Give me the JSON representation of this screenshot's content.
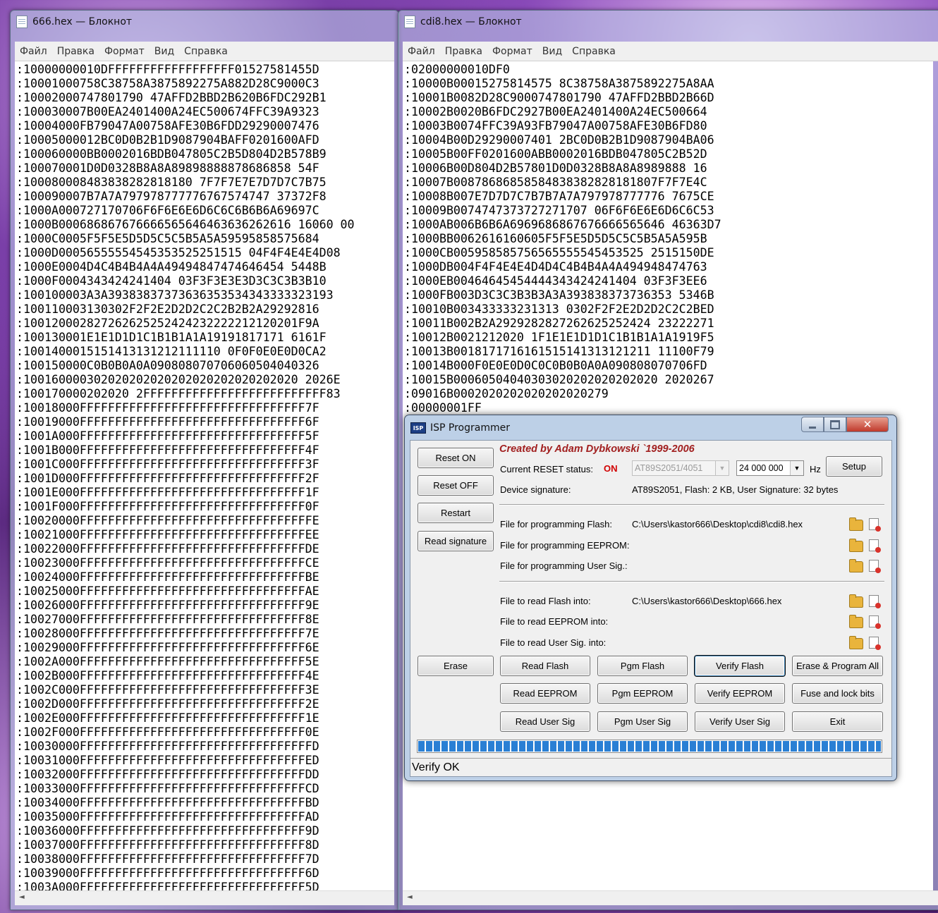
{
  "notepad1": {
    "title": "666.hex — Блокнот",
    "menu": [
      "Файл",
      "Правка",
      "Формат",
      "Вид",
      "Справка"
    ],
    "lines": [
      ":10000000010DFFFFFFFFFFFFFFFFFF01527581455D",
      ":10001000758C38758A3875892275A882D28C9000C3",
      ":10002000747801790 47AFFD2BBD2B620B6FDC292B1",
      ":100030007B00EA2401400A24EC500674FFC39A9323",
      ":10004000FB79047A00758AFE30B6FDD29290007476",
      ":10005000012BC0D0B2B1D9087904BAFF0201600AFD",
      ":100060000BB0002016BDB047805C2B5D804D2B578B9",
      ":100070001D0D0328B8A8A89898888878686858 54F",
      ":100080008483838282818180 7F7F7E7E7D7D7C7B75",
      ":100090007B7A7A797978777776767574747 37372F8",
      ":1000A000727170706F6F6E6E6D6C6C6B6B6A69697C",
      ":1000B000686867676666565646463636262616 16060 00",
      ":1000C0005F5F5E5D5D5C5C5B5A5A59595858575684",
      ":1000D00056555554545353525251515 04F4F4E4E4D08",
      ":1000E0004D4C4B4B4A4A49494847474646454 5448B",
      ":1000F0004343424241404 03F3F3E3E3D3C3C3B3B10",
      ":100100003A3A39383837373636353534343333323193",
      ":100110003130302F2F2E2D2D2C2C2B2B2A29292816",
      ":100120002827262625252424232222212120201F9A",
      ":100130001E1E1D1D1C1B1B1A1A19191817171 6161F",
      ":1001400015151413131212111110 0F0F0E0E0D0CA2",
      ":100150000C0B0B0A0A090808070706060504040326",
      ":100160000302020202020202020202020202020 2026E",
      ":100170000202020 2FFFFFFFFFFFFFFFFFFFFFFFFFF83",
      ":10018000FFFFFFFFFFFFFFFFFFFFFFFFFFFFFFFF7F",
      ":10019000FFFFFFFFFFFFFFFFFFFFFFFFFFFFFFFF6F",
      ":1001A000FFFFFFFFFFFFFFFFFFFFFFFFFFFFFFFF5F",
      ":1001B000FFFFFFFFFFFFFFFFFFFFFFFFFFFFFFFF4F",
      ":1001C000FFFFFFFFFFFFFFFFFFFFFFFFFFFFFFFF3F",
      ":1001D000FFFFFFFFFFFFFFFFFFFFFFFFFFFFFFFF2F",
      ":1001E000FFFFFFFFFFFFFFFFFFFFFFFFFFFFFFFF1F",
      ":1001F000FFFFFFFFFFFFFFFFFFFFFFFFFFFFFFFF0F",
      ":10020000FFFFFFFFFFFFFFFFFFFFFFFFFFFFFFFFFE",
      ":10021000FFFFFFFFFFFFFFFFFFFFFFFFFFFFFFFFEE",
      ":10022000FFFFFFFFFFFFFFFFFFFFFFFFFFFFFFFFDE",
      ":10023000FFFFFFFFFFFFFFFFFFFFFFFFFFFFFFFFCE",
      ":10024000FFFFFFFFFFFFFFFFFFFFFFFFFFFFFFFFBE",
      ":10025000FFFFFFFFFFFFFFFFFFFFFFFFFFFFFFFFAE",
      ":10026000FFFFFFFFFFFFFFFFFFFFFFFFFFFFFFFF9E",
      ":10027000FFFFFFFFFFFFFFFFFFFFFFFFFFFFFFFF8E",
      ":10028000FFFFFFFFFFFFFFFFFFFFFFFFFFFFFFFF7E",
      ":10029000FFFFFFFFFFFFFFFFFFFFFFFFFFFFFFFF6E",
      ":1002A000FFFFFFFFFFFFFFFFFFFFFFFFFFFFFFFF5E",
      ":1002B000FFFFFFFFFFFFFFFFFFFFFFFFFFFFFFFF4E",
      ":1002C000FFFFFFFFFFFFFFFFFFFFFFFFFFFFFFFF3E",
      ":1002D000FFFFFFFFFFFFFFFFFFFFFFFFFFFFFFFF2E",
      ":1002E000FFFFFFFFFFFFFFFFFFFFFFFFFFFFFFFF1E",
      ":1002F000FFFFFFFFFFFFFFFFFFFFFFFFFFFFFFFF0E",
      ":10030000FFFFFFFFFFFFFFFFFFFFFFFFFFFFFFFFFD",
      ":10031000FFFFFFFFFFFFFFFFFFFFFFFFFFFFFFFFED",
      ":10032000FFFFFFFFFFFFFFFFFFFFFFFFFFFFFFFFDD",
      ":10033000FFFFFFFFFFFFFFFFFFFFFFFFFFFFFFFFCD",
      ":10034000FFFFFFFFFFFFFFFFFFFFFFFFFFFFFFFFBD",
      ":10035000FFFFFFFFFFFFFFFFFFFFFFFFFFFFFFFFAD",
      ":10036000FFFFFFFFFFFFFFFFFFFFFFFFFFFFFFFF9D",
      ":10037000FFFFFFFFFFFFFFFFFFFFFFFFFFFFFFFF8D",
      ":10038000FFFFFFFFFFFFFFFFFFFFFFFFFFFFFFFF7D",
      ":10039000FFFFFFFFFFFFFFFFFFFFFFFFFFFFFFFF6D",
      ":1003A000FFFFFFFFFFFFFFFFFFFFFFFFFFFFFFFF5D"
    ]
  },
  "notepad2": {
    "title": "cdi8.hex — Блокнот",
    "menu": [
      "Файл",
      "Правка",
      "Формат",
      "Вид",
      "Справка"
    ],
    "lines": [
      ":02000000010DF0",
      ":10000B00015275814575 8C38758A3875892275A8AA",
      ":10001B0082D28C9000747801790 47AFFD2BBD2B66D",
      ":10002B0020B6FDC2927B00EA2401400A24EC500664",
      ":10003B0074FFC39A93FB79047A00758AFE30B6FD80",
      ":10004B00D29290007401 2BC0D0B2B1D9087904BA06",
      ":10005B00FF0201600ABB0002016BDB047805C2B52D",
      ":10006B00D804D2B57801D0D0328B8A8A8989888 16",
      ":10007B00878686858584838382828181807F7F7E4C",
      ":10008B007E7D7D7C7B7B7A7A797978777776 7675CE",
      ":10009B0074747373727271707 06F6F6E6E6D6C6C53",
      ":1000AB006B6B6A6969686867676666565646 46363D7",
      ":1000BB0062616160605F5F5E5D5D5C5C5B5A5A595B",
      ":1000CB005958585756565555545453525 2515150DE",
      ":1000DB004F4F4E4E4D4D4C4B4B4A4A494948474763",
      ":1000EB00464645454444343424241404 03F3F3EE6",
      ":1000FB003D3C3C3B3B3A3A393838373736353 5346B",
      ":10010B003433333231313 0302F2F2E2D2D2C2C2BED",
      ":10011B002B2A2929282827262625252424 23222271",
      ":10012B0021212020 1F1E1E1D1D1C1B1B1A1A1919F5",
      ":10013B0018171716161515141313121211 11100F79",
      ":10014B000F0E0E0D0C0C0B0B0A0A090808070706FD",
      ":10015B00060504040303020202020202020 2020267",
      ":09016B0002020202020202020279",
      ":00000001FF"
    ]
  },
  "isp": {
    "title": "ISP Programmer",
    "icon_label": "ISP",
    "credit": "Created by Adam Dybkowski `1999-2006",
    "buttons": {
      "reset_on": "Reset ON",
      "reset_off": "Reset OFF",
      "restart": "Restart",
      "read_signature": "Read signature",
      "setup": "Setup",
      "erase": "Erase",
      "read_flash": "Read Flash",
      "pgm_flash": "Pgm Flash",
      "verify_flash": "Verify Flash",
      "erase_program_all": "Erase & Program All",
      "read_eeprom": "Read EEPROM",
      "pgm_eeprom": "Pgm EEPROM",
      "verify_eeprom": "Verify EEPROM",
      "fuse_lock": "Fuse and lock bits",
      "read_user_sig": "Read User Sig",
      "pgm_user_sig": "Pgm User Sig",
      "verify_user_sig": "Verify User Sig",
      "exit": "Exit"
    },
    "labels": {
      "current_reset": "Current RESET status:",
      "reset_value": "ON",
      "device": "AT89S2051/4051",
      "frequency": "24 000 000",
      "hz": "Hz",
      "device_signature": "Device signature:",
      "signature_value": "AT89S2051, Flash: 2 KB, User Signature: 32 bytes",
      "prog_flash": "File for programming Flash:",
      "prog_flash_path": "C:\\Users\\kastor666\\Desktop\\cdi8\\cdi8.hex",
      "prog_eeprom": "File for programming EEPROM:",
      "prog_user": "File for programming User Sig.:",
      "read_flash_into": "File to read Flash into:",
      "read_flash_path": "C:\\Users\\kastor666\\Desktop\\666.hex",
      "read_eeprom_into": "File to read EEPROM into:",
      "read_user_into": "File to read User Sig. into:"
    },
    "progress": 1.0,
    "status": "Verify OK",
    "colors": {
      "credit": "#a11f1f",
      "status_on": "#d10000",
      "progress": "#2a7fd4"
    }
  }
}
